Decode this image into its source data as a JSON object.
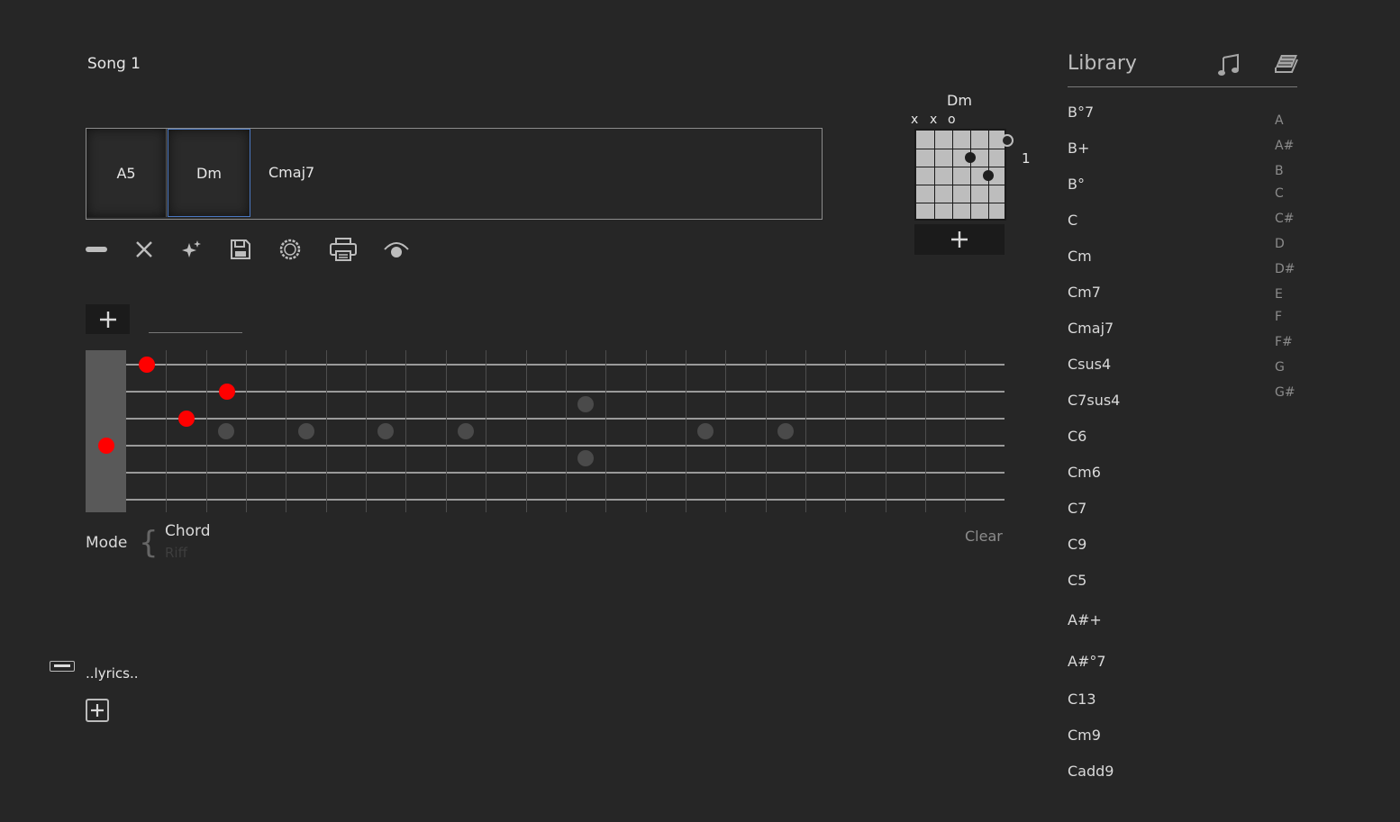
{
  "song": {
    "title": "Song 1"
  },
  "chord_strip": {
    "chords": [
      "A5",
      "Dm",
      "Cmaj7"
    ],
    "selected": "Dm"
  },
  "toolbar": {
    "icons": [
      "minus-icon",
      "close-icon",
      "sparkle-icon",
      "save-icon",
      "circle-icon",
      "print-icon",
      "eye-icon"
    ]
  },
  "fretboard": {
    "strings": 6,
    "inlay_frets": [
      3,
      5,
      7,
      9,
      12,
      15,
      17
    ],
    "notes": [
      {
        "string": 1,
        "fret": 1
      },
      {
        "string": 2,
        "fret": 3
      },
      {
        "string": 3,
        "fret": 2
      },
      {
        "string": 4,
        "fret": 0
      }
    ]
  },
  "mode": {
    "label": "Mode",
    "options": [
      "Chord",
      "Riff"
    ],
    "selected": "Chord"
  },
  "clear": {
    "label": "Clear"
  },
  "lyrics": {
    "text": "..lyrics.."
  },
  "diagram": {
    "name": "Dm",
    "string_marks": [
      "x",
      "x",
      "o"
    ],
    "fret_number": "1",
    "dots": [
      {
        "string": 6,
        "fret": 1
      },
      {
        "string": 4,
        "fret": 2
      },
      {
        "string": 5,
        "fret": 3
      }
    ]
  },
  "library": {
    "title": "Library",
    "items": [
      "B°7",
      "B+",
      "B°",
      "C",
      "Cm",
      "Cm7",
      "Cmaj7",
      "Csus4",
      "C7sus4",
      "C6",
      "Cm6",
      "C7",
      "C9",
      "C5",
      "A#+",
      "A#°7",
      "C13",
      "Cm9",
      "Cadd9"
    ],
    "roots": [
      "A",
      "A#",
      "B",
      "C",
      "C#",
      "D",
      "D#",
      "E",
      "F",
      "F#",
      "G",
      "G#"
    ]
  },
  "colors": {
    "note": "#ff0000",
    "selected_border": "#4a78c2",
    "background": "#262626"
  }
}
